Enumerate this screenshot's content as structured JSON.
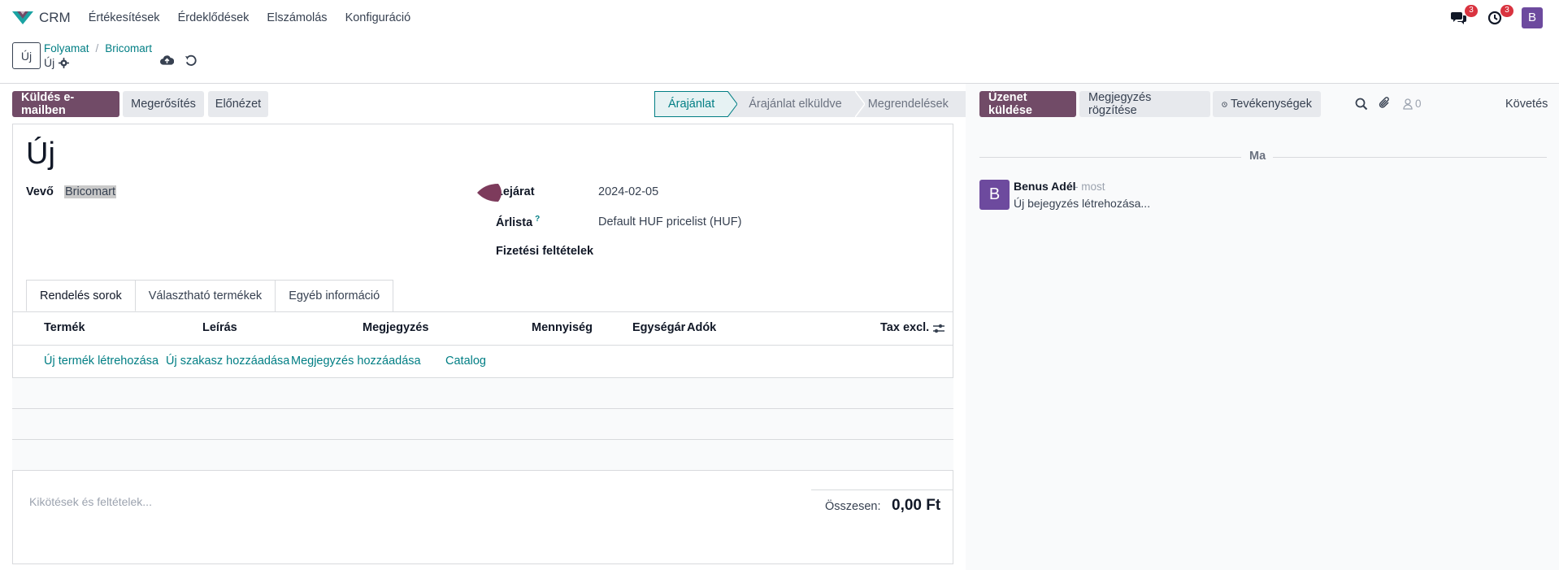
{
  "navbar": {
    "app_name": "CRM",
    "menu": [
      "Értékesítések",
      "Érdeklődések",
      "Elszámolás",
      "Konfiguráció"
    ],
    "messages_count": "3",
    "activities_count": "3",
    "user_initial": "B"
  },
  "control_panel": {
    "new_label": "Új",
    "breadcrumb": [
      "Folyamat",
      "Bricomart"
    ],
    "record_name": "Új"
  },
  "actions": {
    "send_email": "Küldés e-mailben",
    "confirm": "Megerősítés",
    "preview": "Előnézet"
  },
  "statusbar": [
    "Árajánlat",
    "Árajánlat elküldve",
    "Megrendelések"
  ],
  "form": {
    "title": "Új",
    "customer_label": "Vevő",
    "customer_value": "Bricomart",
    "expiration_label": "Lejárat",
    "expiration_value": "2024-02-05",
    "pricelist_label": "Árlista",
    "pricelist_help": "?",
    "pricelist_value": "Default HUF pricelist (HUF)",
    "payment_terms_label": "Fizetési feltételek",
    "payment_terms_value": ""
  },
  "tabs": [
    "Rendelés sorok",
    "Választható termékek",
    "Egyéb információ"
  ],
  "order_lines": {
    "columns": [
      "Termék",
      "Leírás",
      "Megjegyzés",
      "Mennyiség",
      "Egységár",
      "Adók",
      "Tax excl."
    ],
    "add_links": [
      "Új termék létrehozása",
      "Új szakasz hozzáadása",
      "Megjegyzés hozzáadása",
      "Catalog"
    ],
    "rows": []
  },
  "footer": {
    "terms_placeholder": "Kikötések és feltételek...",
    "total_label": "Összesen:",
    "total_value": "0,00 Ft"
  },
  "chatter": {
    "send_message": "Üzenet küldése",
    "log_note": "Megjegyzés rögzítése",
    "activities": "Tevékenységek",
    "followers_count": "0",
    "follow": "Követés",
    "date_separator": "Ma",
    "messages": [
      {
        "avatar": "B",
        "author": "Benus Adél",
        "time": "- most",
        "body": "Új bejegyzés létrehozása..."
      }
    ]
  },
  "colors": {
    "primary": "#714b67",
    "link": "#017e84",
    "badge": "#d9333f",
    "avatar": "#6d4a9e"
  }
}
